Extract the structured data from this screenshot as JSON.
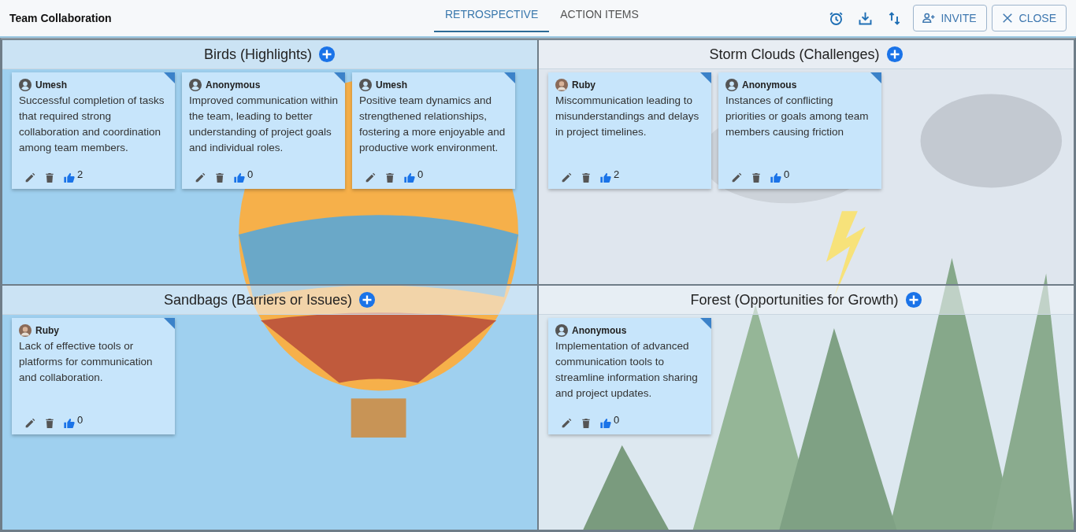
{
  "app_title": "Team Collaboration",
  "tabs": [
    {
      "label": "RETROSPECTIVE",
      "selected": true
    },
    {
      "label": "ACTION ITEMS",
      "selected": false
    }
  ],
  "toolbar": {
    "invite": "INVITE",
    "close": "CLOSE"
  },
  "sections": [
    {
      "title": "Birds (Highlights)",
      "cards": [
        {
          "author": "Umesh",
          "avatar": {
            "kind": "default"
          },
          "text": "Successful completion of tasks that required strong collaboration and coordination among team members.",
          "likes": "2"
        },
        {
          "author": "Anonymous",
          "avatar": {
            "kind": "default"
          },
          "text": "Improved communication within the team, leading to better understanding of project goals and individual roles.",
          "likes": "0"
        },
        {
          "author": "Umesh",
          "avatar": {
            "kind": "default"
          },
          "text": "Positive team dynamics and strengthened relationships, fostering a more enjoyable and productive work environment.",
          "likes": "0"
        }
      ]
    },
    {
      "title": "Storm Clouds (Challenges)",
      "cards": [
        {
          "author": "Ruby",
          "text": "Miscommunication leading to misunderstandings and delays in project timelines.",
          "likes": "2"
        },
        {
          "author": "Anonymous",
          "avatar": {
            "kind": "default"
          },
          "text": "Instances of conflicting priorities or goals among team members causing friction",
          "likes": "0"
        }
      ]
    },
    {
      "title": "Sandbags (Barriers or Issues)",
      "cards": [
        {
          "author": "Ruby",
          "text": "Lack of effective tools or platforms for communication and collaboration.",
          "likes": "0"
        }
      ]
    },
    {
      "title": "Forest (Opportunities for Growth)",
      "cards": [
        {
          "author": "Anonymous",
          "avatar": {
            "kind": "default"
          },
          "text": "Implementation of advanced communication tools to streamline information sharing and project updates.",
          "likes": "0"
        }
      ]
    }
  ]
}
